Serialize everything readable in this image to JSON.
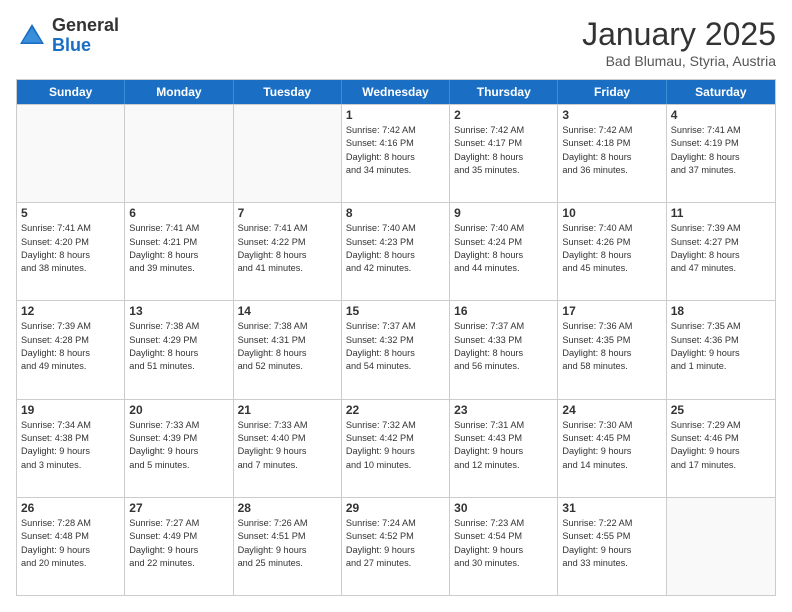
{
  "logo": {
    "general": "General",
    "blue": "Blue"
  },
  "header": {
    "month": "January 2025",
    "location": "Bad Blumau, Styria, Austria"
  },
  "weekdays": [
    "Sunday",
    "Monday",
    "Tuesday",
    "Wednesday",
    "Thursday",
    "Friday",
    "Saturday"
  ],
  "rows": [
    [
      {
        "day": "",
        "info": ""
      },
      {
        "day": "",
        "info": ""
      },
      {
        "day": "",
        "info": ""
      },
      {
        "day": "1",
        "info": "Sunrise: 7:42 AM\nSunset: 4:16 PM\nDaylight: 8 hours\nand 34 minutes."
      },
      {
        "day": "2",
        "info": "Sunrise: 7:42 AM\nSunset: 4:17 PM\nDaylight: 8 hours\nand 35 minutes."
      },
      {
        "day": "3",
        "info": "Sunrise: 7:42 AM\nSunset: 4:18 PM\nDaylight: 8 hours\nand 36 minutes."
      },
      {
        "day": "4",
        "info": "Sunrise: 7:41 AM\nSunset: 4:19 PM\nDaylight: 8 hours\nand 37 minutes."
      }
    ],
    [
      {
        "day": "5",
        "info": "Sunrise: 7:41 AM\nSunset: 4:20 PM\nDaylight: 8 hours\nand 38 minutes."
      },
      {
        "day": "6",
        "info": "Sunrise: 7:41 AM\nSunset: 4:21 PM\nDaylight: 8 hours\nand 39 minutes."
      },
      {
        "day": "7",
        "info": "Sunrise: 7:41 AM\nSunset: 4:22 PM\nDaylight: 8 hours\nand 41 minutes."
      },
      {
        "day": "8",
        "info": "Sunrise: 7:40 AM\nSunset: 4:23 PM\nDaylight: 8 hours\nand 42 minutes."
      },
      {
        "day": "9",
        "info": "Sunrise: 7:40 AM\nSunset: 4:24 PM\nDaylight: 8 hours\nand 44 minutes."
      },
      {
        "day": "10",
        "info": "Sunrise: 7:40 AM\nSunset: 4:26 PM\nDaylight: 8 hours\nand 45 minutes."
      },
      {
        "day": "11",
        "info": "Sunrise: 7:39 AM\nSunset: 4:27 PM\nDaylight: 8 hours\nand 47 minutes."
      }
    ],
    [
      {
        "day": "12",
        "info": "Sunrise: 7:39 AM\nSunset: 4:28 PM\nDaylight: 8 hours\nand 49 minutes."
      },
      {
        "day": "13",
        "info": "Sunrise: 7:38 AM\nSunset: 4:29 PM\nDaylight: 8 hours\nand 51 minutes."
      },
      {
        "day": "14",
        "info": "Sunrise: 7:38 AM\nSunset: 4:31 PM\nDaylight: 8 hours\nand 52 minutes."
      },
      {
        "day": "15",
        "info": "Sunrise: 7:37 AM\nSunset: 4:32 PM\nDaylight: 8 hours\nand 54 minutes."
      },
      {
        "day": "16",
        "info": "Sunrise: 7:37 AM\nSunset: 4:33 PM\nDaylight: 8 hours\nand 56 minutes."
      },
      {
        "day": "17",
        "info": "Sunrise: 7:36 AM\nSunset: 4:35 PM\nDaylight: 8 hours\nand 58 minutes."
      },
      {
        "day": "18",
        "info": "Sunrise: 7:35 AM\nSunset: 4:36 PM\nDaylight: 9 hours\nand 1 minute."
      }
    ],
    [
      {
        "day": "19",
        "info": "Sunrise: 7:34 AM\nSunset: 4:38 PM\nDaylight: 9 hours\nand 3 minutes."
      },
      {
        "day": "20",
        "info": "Sunrise: 7:33 AM\nSunset: 4:39 PM\nDaylight: 9 hours\nand 5 minutes."
      },
      {
        "day": "21",
        "info": "Sunrise: 7:33 AM\nSunset: 4:40 PM\nDaylight: 9 hours\nand 7 minutes."
      },
      {
        "day": "22",
        "info": "Sunrise: 7:32 AM\nSunset: 4:42 PM\nDaylight: 9 hours\nand 10 minutes."
      },
      {
        "day": "23",
        "info": "Sunrise: 7:31 AM\nSunset: 4:43 PM\nDaylight: 9 hours\nand 12 minutes."
      },
      {
        "day": "24",
        "info": "Sunrise: 7:30 AM\nSunset: 4:45 PM\nDaylight: 9 hours\nand 14 minutes."
      },
      {
        "day": "25",
        "info": "Sunrise: 7:29 AM\nSunset: 4:46 PM\nDaylight: 9 hours\nand 17 minutes."
      }
    ],
    [
      {
        "day": "26",
        "info": "Sunrise: 7:28 AM\nSunset: 4:48 PM\nDaylight: 9 hours\nand 20 minutes."
      },
      {
        "day": "27",
        "info": "Sunrise: 7:27 AM\nSunset: 4:49 PM\nDaylight: 9 hours\nand 22 minutes."
      },
      {
        "day": "28",
        "info": "Sunrise: 7:26 AM\nSunset: 4:51 PM\nDaylight: 9 hours\nand 25 minutes."
      },
      {
        "day": "29",
        "info": "Sunrise: 7:24 AM\nSunset: 4:52 PM\nDaylight: 9 hours\nand 27 minutes."
      },
      {
        "day": "30",
        "info": "Sunrise: 7:23 AM\nSunset: 4:54 PM\nDaylight: 9 hours\nand 30 minutes."
      },
      {
        "day": "31",
        "info": "Sunrise: 7:22 AM\nSunset: 4:55 PM\nDaylight: 9 hours\nand 33 minutes."
      },
      {
        "day": "",
        "info": ""
      }
    ]
  ]
}
